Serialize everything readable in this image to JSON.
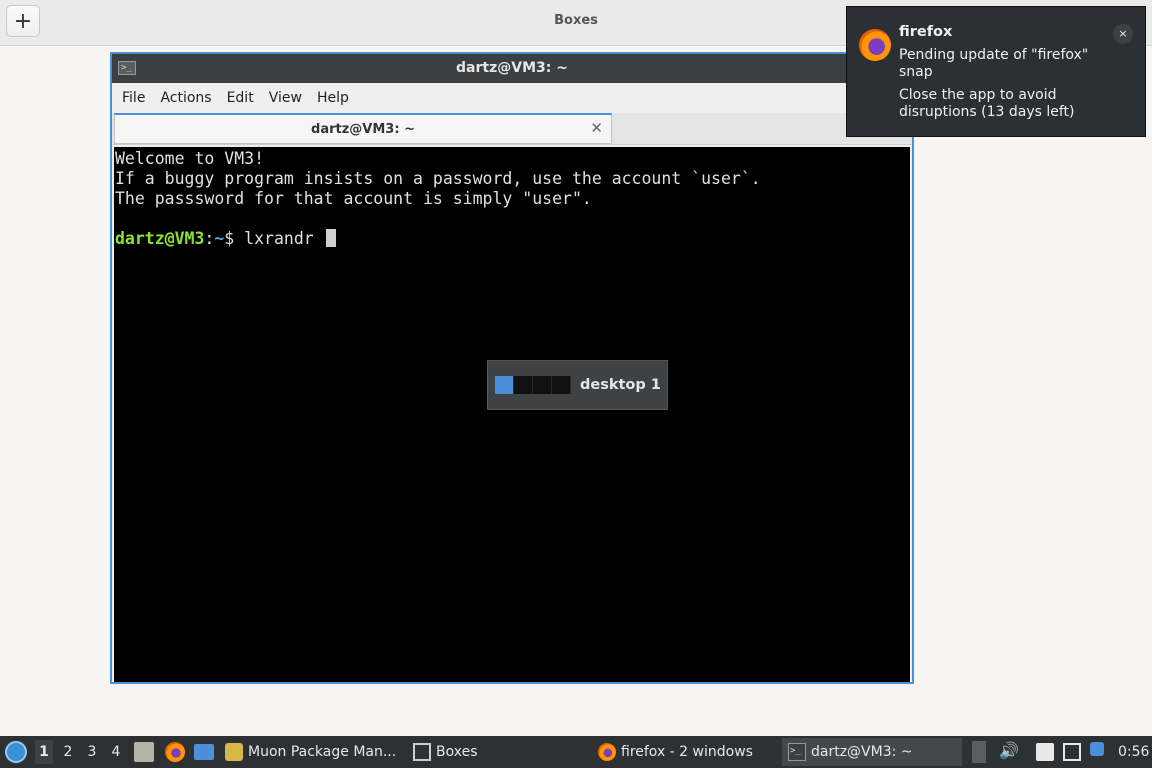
{
  "boxes": {
    "title": "Boxes",
    "add_label": "+"
  },
  "terminal": {
    "window_title": "dartz@VM3: ~",
    "menu": [
      "File",
      "Actions",
      "Edit",
      "View",
      "Help"
    ],
    "tab_label": "dartz@VM3: ~",
    "tab_close": "✕",
    "lines": [
      "Welcome to VM3!",
      "If a buggy program insists on a password, use the account `user`.",
      "The passsword for that account is simply \"user\"."
    ],
    "prompt_user_host": "dartz@VM3",
    "prompt_colon": ":",
    "prompt_dir": "~",
    "prompt_symbol": "$ ",
    "command": "lxrandr"
  },
  "desktop_osd": {
    "label": "desktop 1",
    "desktops": 4,
    "active_index": 0
  },
  "notification": {
    "app": "firefox",
    "summary": "Pending update of \"firefox\" snap",
    "body": "Close the app to avoid disruptions (13 days left)",
    "close": "×"
  },
  "taskbar": {
    "workspaces": [
      "1",
      "2",
      "3",
      "4"
    ],
    "active_workspace": "1",
    "tasks": {
      "muon": "Muon Package Man...",
      "boxes": "Boxes",
      "firefox": "firefox - 2 windows",
      "terminal": "dartz@VM3: ~"
    },
    "volume_icon": "🔊",
    "clock": "0:56"
  },
  "colors": {
    "accent": "#4a90d9",
    "prompt_user": "#8ae234",
    "prompt_dir": "#729fcf",
    "terminal_bg": "#000000"
  }
}
